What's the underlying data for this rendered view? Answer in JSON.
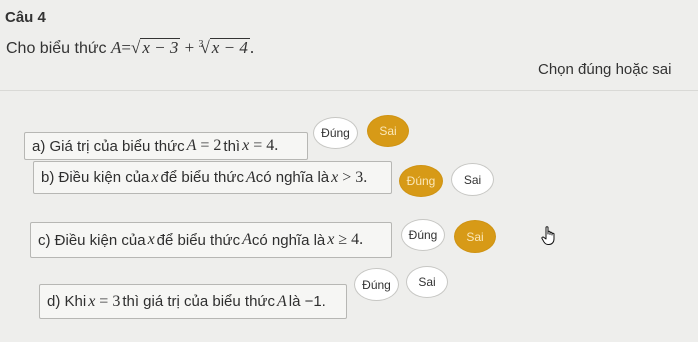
{
  "question": {
    "title": "Câu 4",
    "prompt_prefix": "Cho biểu thức ",
    "expr_lhs": "A",
    "expr_eq": "=",
    "expr_sqrt_inner": "x − 3",
    "expr_plus": " + ",
    "expr_cbrt_index": "3",
    "expr_cbrt_inner": "x − 4",
    "expr_end": "."
  },
  "instruction": "Chọn đúng hoặc sai",
  "colors": {
    "selected": "#d79a17",
    "background": "#eeeeec"
  },
  "statements": [
    {
      "id": "a",
      "parts": [
        "a) Giá trị của biểu thức ",
        "A",
        " = 2",
        " thì ",
        "x",
        " = 4."
      ],
      "true_label": "Đúng",
      "false_label": "Sai",
      "selected": "false"
    },
    {
      "id": "b",
      "parts": [
        "b) Điều kiện của ",
        "x",
        " để biểu thức ",
        "A",
        "có nghĩa là ",
        "x",
        " > 3."
      ],
      "true_label": "Đúng",
      "false_label": "Sai",
      "selected": "true"
    },
    {
      "id": "c",
      "parts": [
        "c) Điều kiện của ",
        "x",
        " để biểu thức ",
        "A",
        "có nghĩa là ",
        "x",
        " ≥ 4."
      ],
      "true_label": "Đúng",
      "false_label": "Sai",
      "selected": "false"
    },
    {
      "id": "d",
      "parts": [
        "d) Khi ",
        "x",
        " = 3",
        " thì giá trị của biểu thức ",
        "A",
        " là −1."
      ],
      "true_label": "Đúng",
      "false_label": "Sai",
      "selected": null
    }
  ],
  "icons": {
    "cursor": "hand-pointer-icon"
  }
}
